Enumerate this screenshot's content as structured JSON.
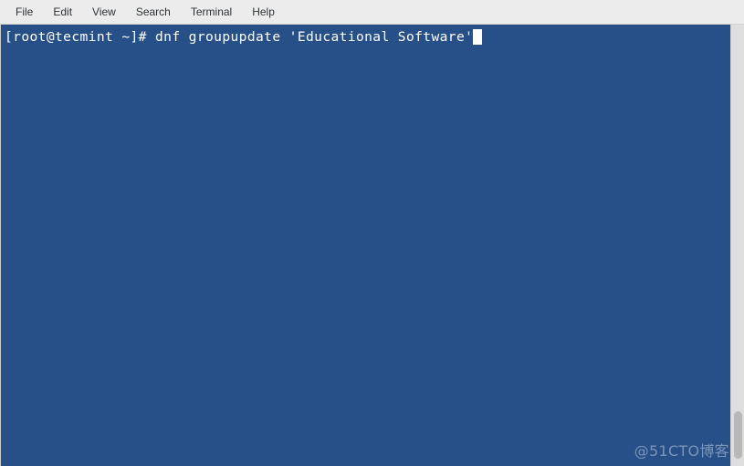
{
  "window": {
    "title": "Terminal",
    "background_color": "#274f88",
    "foreground_color": "#ffffff"
  },
  "menubar": {
    "background_color": "#ececec",
    "items": [
      {
        "label": "File"
      },
      {
        "label": "Edit"
      },
      {
        "label": "View"
      },
      {
        "label": "Search"
      },
      {
        "label": "Terminal"
      },
      {
        "label": "Help"
      }
    ]
  },
  "terminal": {
    "lines": [
      {
        "prompt": "[root@tecmint ~]# ",
        "command": "dnf groupupdate 'Educational Software'",
        "full_text": "[root@tecmint ~]# dnf groupupdate 'Educational Software'",
        "has_cursor": true
      }
    ],
    "user": "root",
    "host": "tecmint",
    "working_directory": "~",
    "prompt_symbol": "#"
  },
  "scrollbar": {
    "orientation": "vertical",
    "thumb_position": "bottom"
  },
  "watermark": {
    "text": "@51CTO博客"
  }
}
